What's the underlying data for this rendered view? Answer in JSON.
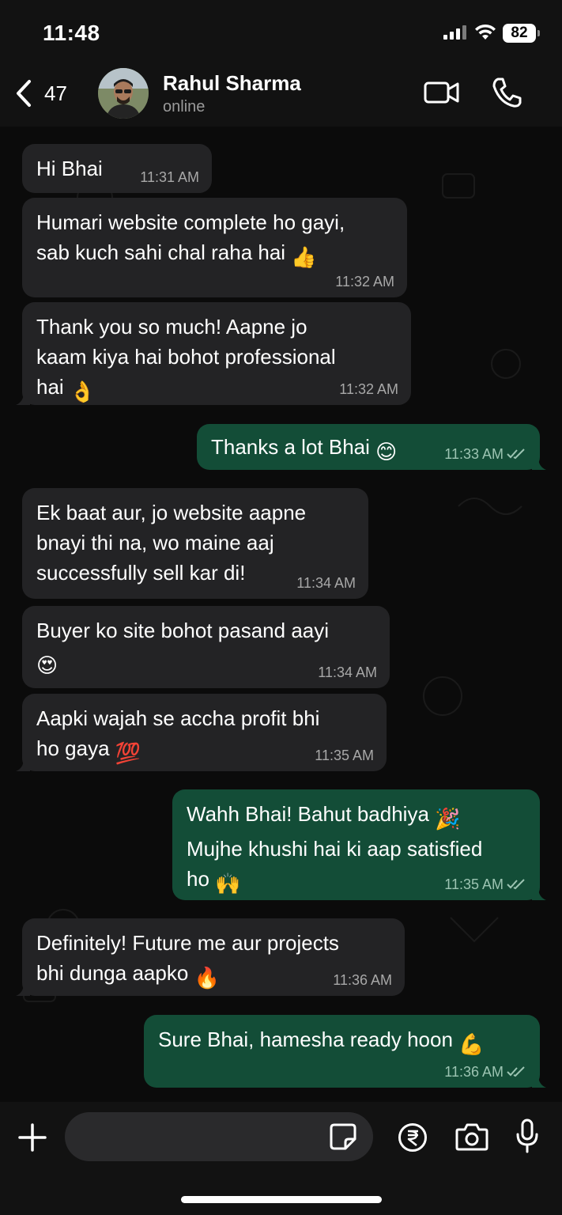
{
  "status_bar": {
    "time": "11:48",
    "battery": "82"
  },
  "header": {
    "back_count": "47",
    "contact_name": "Rahul Sharma",
    "contact_status": "online"
  },
  "messages": [
    {
      "direction": "in",
      "text": "Hi Bhai",
      "time": "11:31 AM"
    },
    {
      "direction": "in",
      "text": "Humari website complete ho gayi, sab kuch sahi chal raha hai 👍",
      "line1": "Humari website complete ho gayi,",
      "line2": "sab kuch sahi chal raha hai",
      "emoji": "👍",
      "time": "11:32 AM"
    },
    {
      "direction": "in",
      "line1": "Thank you so much!  Aapne jo",
      "line2": "kaam kiya hai bohot professional",
      "line3": "hai",
      "emoji": "👌",
      "time": "11:32 AM"
    },
    {
      "direction": "out",
      "line1": "Thanks a lot Bhai",
      "emoji": "😊",
      "time": "11:33 AM",
      "status": "read"
    },
    {
      "direction": "in",
      "line1": "Ek baat aur, jo website aapne",
      "line2": "bnayi thi na, wo maine aaj",
      "line3": "successfully sell kar di!",
      "time": "11:34 AM"
    },
    {
      "direction": "in",
      "line1": "Buyer ko site bohot pasand aayi",
      "emoji": "😍",
      "time": "11:34 AM"
    },
    {
      "direction": "in",
      "line1": "Aapki wajah se accha profit bhi",
      "line2": "ho gaya",
      "emoji": "💯",
      "time": "11:35 AM"
    },
    {
      "direction": "out",
      "line1": "Wahh Bhai! Bahut badhiya",
      "emoji1": "🎉",
      "line2": "Mujhe khushi hai ki aap satisfied",
      "line3": "ho",
      "emoji": "🙌",
      "time": "11:35 AM",
      "status": "read"
    },
    {
      "direction": "in",
      "line1": "Definitely! Future me aur projects",
      "line2": "bhi dunga aapko",
      "emoji": "🔥",
      "time": "11:36 AM"
    },
    {
      "direction": "out",
      "line1": "Sure Bhai, hamesha ready hoon",
      "emoji": "💪",
      "time": "11:36 AM",
      "status": "read"
    }
  ],
  "input_bar": {
    "message_value": ""
  },
  "icons": {
    "back": "chevron-left-icon",
    "video": "video-camera-icon",
    "call": "phone-icon",
    "plus": "plus-icon",
    "sticker": "sticker-icon",
    "payment": "rupee-icon",
    "camera": "camera-icon",
    "mic": "microphone-icon"
  },
  "colors": {
    "incoming_bubble": "#232325",
    "outgoing_bubble": "#134d37",
    "background": "#0b0b0b"
  }
}
